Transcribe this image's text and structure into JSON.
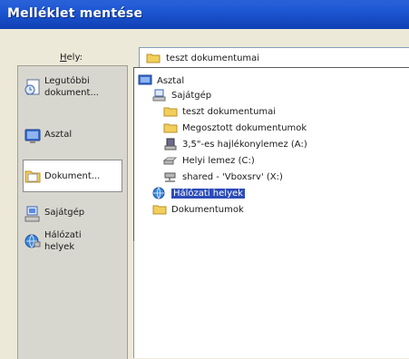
{
  "title": "Melléklet mentése",
  "location": {
    "label_accesskey": "H",
    "label_rest": "ely:",
    "current_value": "teszt dokumentumai"
  },
  "places": [
    {
      "label": "Legutóbbi\ndokument...",
      "icon": "recent-documents-icon"
    },
    {
      "label": "Asztal",
      "icon": "desktop-icon"
    },
    {
      "label": "Dokument...",
      "icon": "documents-folder-icon",
      "selected": true
    },
    {
      "label": "Sajátgép",
      "icon": "my-computer-icon"
    },
    {
      "label": "Hálózati\nhelyek",
      "icon": "network-places-icon"
    }
  ],
  "dropdown_items": [
    {
      "label": "Asztal",
      "icon": "desktop-icon",
      "level": 0
    },
    {
      "label": "Sajátgép",
      "icon": "my-computer-icon",
      "level": 1
    },
    {
      "label": "teszt dokumentumai",
      "icon": "folder-icon",
      "level": 2
    },
    {
      "label": "Megosztott dokumentumok",
      "icon": "folder-icon",
      "level": 2
    },
    {
      "label": "3,5\"-es hajlékonylemez (A:)",
      "icon": "floppy-drive-icon",
      "level": 2
    },
    {
      "label": "Helyi lemez (C:)",
      "icon": "hard-disk-icon",
      "level": 2
    },
    {
      "label": "shared - 'Vboxsrv' (X:)",
      "icon": "network-drive-icon",
      "level": 2
    },
    {
      "label": "Hálózati helyek",
      "icon": "network-places-icon",
      "level": 1,
      "highlighted": true
    },
    {
      "label": "Dokumentumok",
      "icon": "folder-icon",
      "level": 1
    }
  ]
}
